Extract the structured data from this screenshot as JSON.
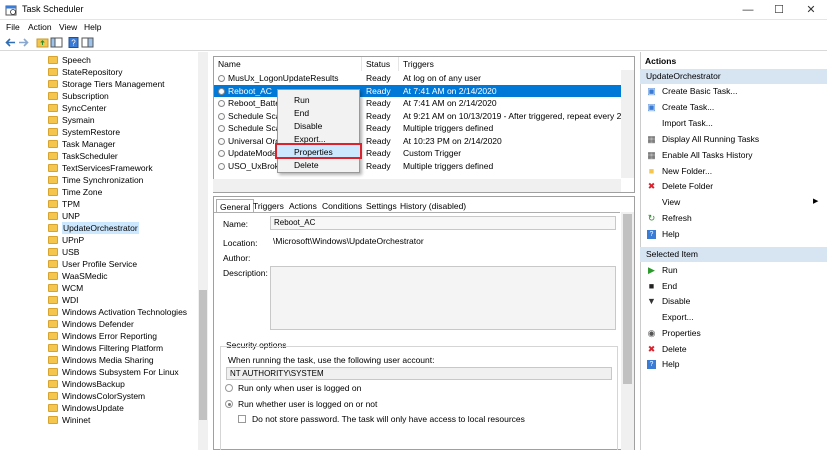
{
  "window": {
    "title": "Task Scheduler"
  },
  "menu": [
    "File",
    "Action",
    "View",
    "Help"
  ],
  "tree": {
    "items": [
      "Speech",
      "StateRepository",
      "Storage Tiers Management",
      "Subscription",
      "SyncCenter",
      "Sysmain",
      "SystemRestore",
      "Task Manager",
      "TaskScheduler",
      "TextServicesFramework",
      "Time Synchronization",
      "Time Zone",
      "TPM",
      "UNP",
      "UpdateOrchestrator",
      "UPnP",
      "USB",
      "User Profile Service",
      "WaaSMedic",
      "WCM",
      "WDI",
      "Windows Activation Technologies",
      "Windows Defender",
      "Windows Error Reporting",
      "Windows Filtering Platform",
      "Windows Media Sharing",
      "Windows Subsystem For Linux",
      "WindowsBackup",
      "WindowsColorSystem",
      "WindowsUpdate",
      "Wininet"
    ],
    "selected": "UpdateOrchestrator"
  },
  "tasklist": {
    "columns": [
      "Name",
      "Status",
      "Triggers"
    ],
    "rows": [
      {
        "name": "MusUx_LogonUpdateResults",
        "status": "Ready",
        "trigger": "At log on of any user"
      },
      {
        "name": "Reboot_AC",
        "status": "Ready",
        "trigger": "At 7:41 AM on 2/14/2020"
      },
      {
        "name": "Reboot_Batte",
        "status": "Ready",
        "trigger": "At 7:41 AM on 2/14/2020"
      },
      {
        "name": "Schedule Sca",
        "status": "Ready",
        "trigger": "At 9:21 AM on 10/13/2019 - After triggered, repeat every 22:00"
      },
      {
        "name": "Schedule Sca",
        "status": "Ready",
        "trigger": "Multiple triggers defined"
      },
      {
        "name": "Universal Orc",
        "status": "Ready",
        "trigger": "At 10:23 PM on 2/14/2020"
      },
      {
        "name": "UpdateModel",
        "status": "Ready",
        "trigger": "Custom Trigger"
      },
      {
        "name": "USO_UxBroke",
        "status": "Ready",
        "trigger": "Multiple triggers defined"
      }
    ]
  },
  "context_menu": [
    "Run",
    "End",
    "Disable",
    "Export...",
    "Properties",
    "Delete"
  ],
  "details": {
    "tabs": [
      "General",
      "Triggers",
      "Actions",
      "Conditions",
      "Settings",
      "History (disabled)"
    ],
    "name_label": "Name:",
    "name_value": "Reboot_AC",
    "location_label": "Location:",
    "location_value": "\\Microsoft\\Windows\\UpdateOrchestrator",
    "author_label": "Author:",
    "description_label": "Description:",
    "security_title": "Security options",
    "account_prompt": "When running the task, use the following user account:",
    "account_value": "NT AUTHORITY\\SYSTEM",
    "radio1": "Run only when user is logged on",
    "radio2": "Run whether user is logged on or not",
    "checkbox": "Do not store password.  The task will only have access to local resources"
  },
  "actions": {
    "header": "Actions",
    "section1": "UpdateOrchestrator",
    "items1": [
      {
        "label": "Create Basic Task...",
        "icon": "create-basic-task-icon"
      },
      {
        "label": "Create Task...",
        "icon": "create-task-icon"
      },
      {
        "label": "Import Task...",
        "icon": "import-icon"
      },
      {
        "label": "Display All Running Tasks",
        "icon": "display-running-icon"
      },
      {
        "label": "Enable All Tasks History",
        "icon": "history-icon"
      },
      {
        "label": "New Folder...",
        "icon": "new-folder-icon"
      },
      {
        "label": "Delete Folder",
        "icon": "delete-icon"
      },
      {
        "label": "View",
        "icon": "view-icon"
      },
      {
        "label": "Refresh",
        "icon": "refresh-icon"
      },
      {
        "label": "Help",
        "icon": "help-icon"
      }
    ],
    "section2": "Selected Item",
    "items2": [
      {
        "label": "Run",
        "icon": "run-icon"
      },
      {
        "label": "End",
        "icon": "end-icon"
      },
      {
        "label": "Disable",
        "icon": "disable-icon"
      },
      {
        "label": "Export...",
        "icon": "export-icon"
      },
      {
        "label": "Properties",
        "icon": "properties-icon"
      },
      {
        "label": "Delete",
        "icon": "delete-icon"
      },
      {
        "label": "Help",
        "icon": "help-icon"
      }
    ]
  },
  "colors": {
    "accent": "#0078d7",
    "highlight": "#d9232e",
    "actions_header_bg": "#d7e4f2"
  }
}
